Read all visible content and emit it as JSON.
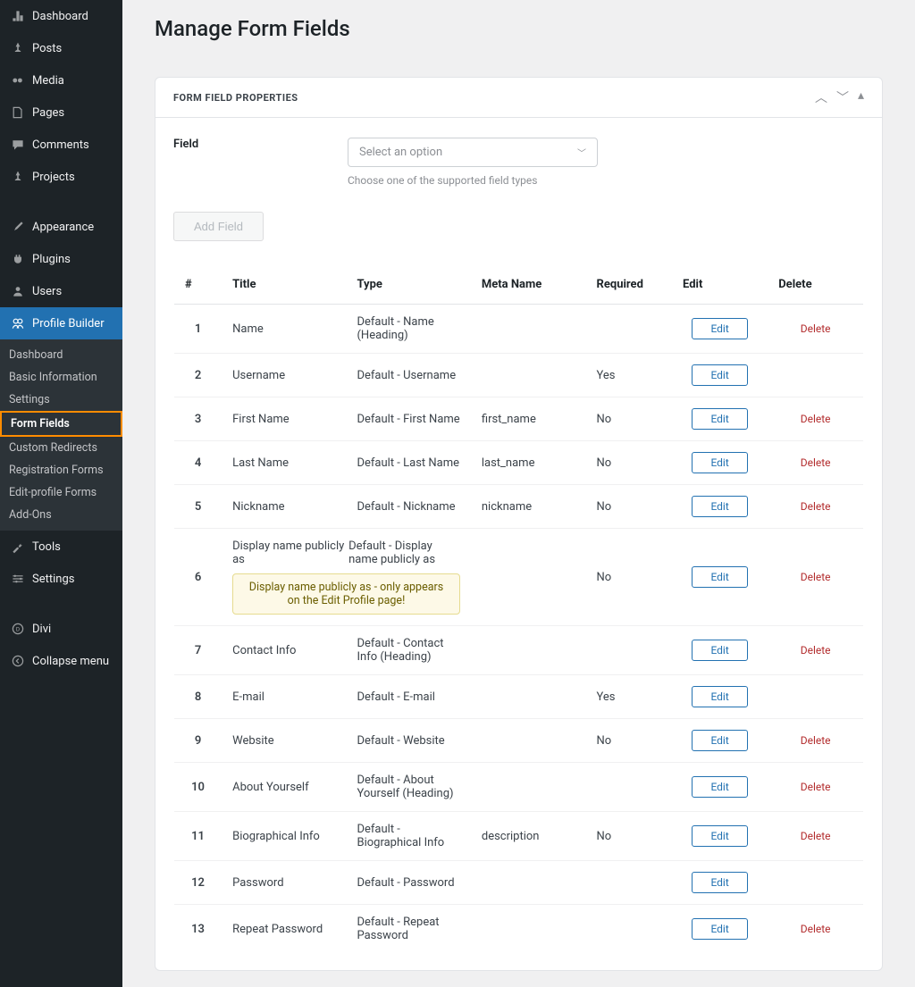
{
  "sidebar": {
    "items": [
      {
        "icon": "dashboard",
        "label": "Dashboard"
      },
      {
        "icon": "pin",
        "label": "Posts"
      },
      {
        "icon": "media",
        "label": "Media"
      },
      {
        "icon": "page",
        "label": "Pages"
      },
      {
        "icon": "comment",
        "label": "Comments"
      },
      {
        "icon": "pin",
        "label": "Projects"
      },
      {
        "icon": "brush",
        "label": "Appearance"
      },
      {
        "icon": "plug",
        "label": "Plugins"
      },
      {
        "icon": "user",
        "label": "Users"
      },
      {
        "icon": "pb",
        "label": "Profile Builder"
      },
      {
        "icon": "wrench",
        "label": "Tools"
      },
      {
        "icon": "sliders",
        "label": "Settings"
      },
      {
        "icon": "divi",
        "label": "Divi"
      },
      {
        "icon": "collapse",
        "label": "Collapse menu"
      }
    ],
    "submenu": [
      "Dashboard",
      "Basic Information",
      "Settings",
      "Form Fields",
      "Custom Redirects",
      "Registration Forms",
      "Edit-profile Forms",
      "Add-Ons"
    ]
  },
  "page": {
    "title": "Manage Form Fields",
    "panel_title": "FORM FIELD PROPERTIES",
    "field_label": "Field",
    "select_placeholder": "Select an option",
    "select_hint": "Choose one of the supported field types",
    "add_field_label": "Add Field",
    "edit_label": "Edit",
    "delete_label": "Delete"
  },
  "table": {
    "headers": [
      "#",
      "Title",
      "Type",
      "Meta Name",
      "Required",
      "Edit",
      "Delete"
    ]
  },
  "rows": [
    {
      "num": "1",
      "title": "Name",
      "type": "Default - Name (Heading)",
      "meta": "",
      "req": "",
      "edit": true,
      "del": true
    },
    {
      "num": "2",
      "title": "Username",
      "type": "Default - Username",
      "meta": "",
      "req": "Yes",
      "edit": true,
      "del": false
    },
    {
      "num": "3",
      "title": "First Name",
      "type": "Default - First Name",
      "meta": "first_name",
      "req": "No",
      "edit": true,
      "del": true
    },
    {
      "num": "4",
      "title": "Last Name",
      "type": "Default - Last Name",
      "meta": "last_name",
      "req": "No",
      "edit": true,
      "del": true
    },
    {
      "num": "5",
      "title": "Nickname",
      "type": "Default - Nickname",
      "meta": "nickname",
      "req": "No",
      "edit": true,
      "del": true
    },
    {
      "num": "6",
      "title": "Display name publicly as",
      "type": "Default - Display name publicly as",
      "meta": "",
      "req": "No",
      "edit": true,
      "del": true,
      "notice": "Display name publicly as - only appears on the Edit Profile page!"
    },
    {
      "num": "7",
      "title": "Contact Info",
      "type": "Default - Contact Info (Heading)",
      "meta": "",
      "req": "",
      "edit": true,
      "del": true
    },
    {
      "num": "8",
      "title": "E-mail",
      "type": "Default - E-mail",
      "meta": "",
      "req": "Yes",
      "edit": true,
      "del": false
    },
    {
      "num": "9",
      "title": "Website",
      "type": "Default - Website",
      "meta": "",
      "req": "No",
      "edit": true,
      "del": true
    },
    {
      "num": "10",
      "title": "About Yourself",
      "type": "Default - About Yourself (Heading)",
      "meta": "",
      "req": "",
      "edit": true,
      "del": true
    },
    {
      "num": "11",
      "title": "Biographical Info",
      "type": "Default - Biographical Info",
      "meta": "description",
      "req": "No",
      "edit": true,
      "del": true
    },
    {
      "num": "12",
      "title": "Password",
      "type": "Default - Password",
      "meta": "",
      "req": "",
      "edit": true,
      "del": false
    },
    {
      "num": "13",
      "title": "Repeat Password",
      "type": "Default - Repeat Password",
      "meta": "",
      "req": "",
      "edit": true,
      "del": true
    }
  ]
}
